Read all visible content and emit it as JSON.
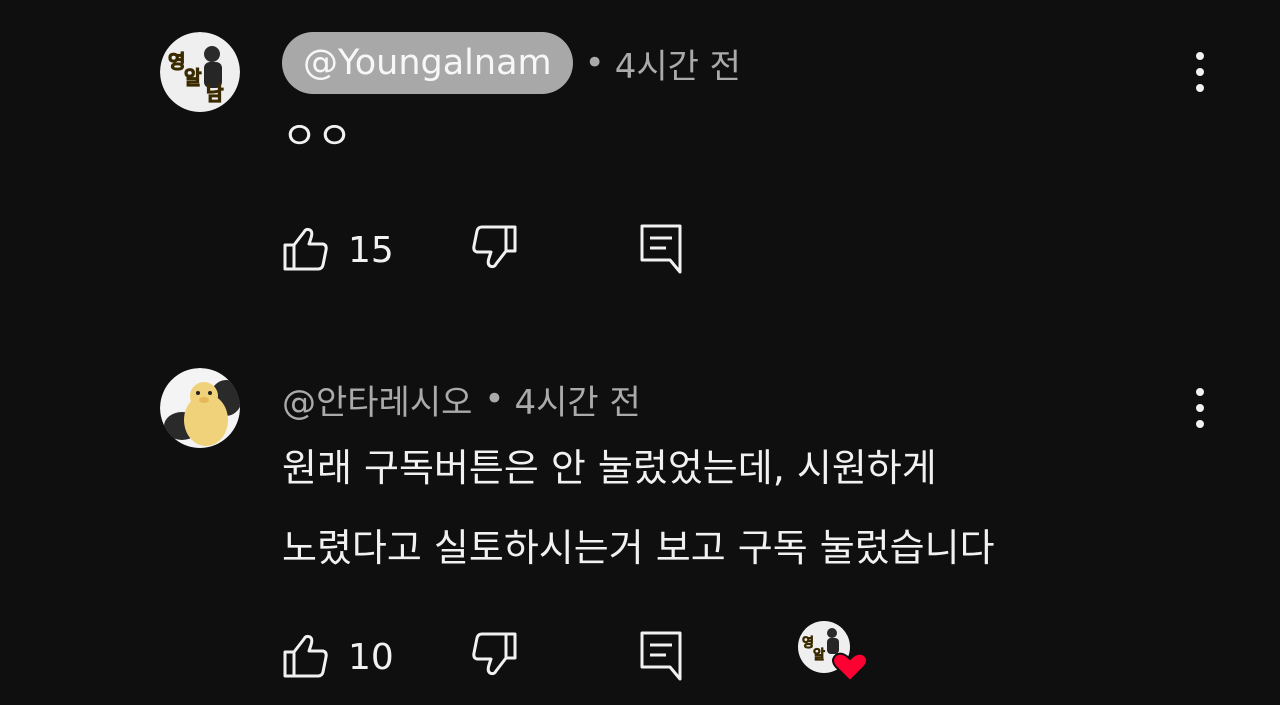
{
  "comments": [
    {
      "author": "@Youngalnam",
      "author_highlighted": true,
      "separator": "•",
      "time": "4시간 전",
      "lines": [
        "ㅇㅇ"
      ],
      "likes": "15",
      "avatar_text": [
        "영",
        "알",
        "남"
      ],
      "hearted": false
    },
    {
      "author": "@안타레시오",
      "author_highlighted": false,
      "separator": "•",
      "time": "4시간 전",
      "lines": [
        "원래 구독버튼은 안 눌렀었는데, 시원하게",
        "노렸다고 실토하시는거 보고 구독 눌렀습니다"
      ],
      "likes": "10",
      "avatar_text": [],
      "hearted": true
    }
  ],
  "colors": {
    "background": "#0f0f0f",
    "text": "#f1f1f1",
    "meta": "#aaaaaa",
    "author_chip": "#a8a8a8",
    "heart": "#ff0033",
    "channel_logo_yellow": "#f2c018"
  },
  "icons": {
    "like": "thumbs-up-icon",
    "dislike": "thumbs-down-icon",
    "reply": "reply-comment-icon",
    "more": "vertical-dots-icon",
    "creator_heart": "creator-heart-icon"
  }
}
